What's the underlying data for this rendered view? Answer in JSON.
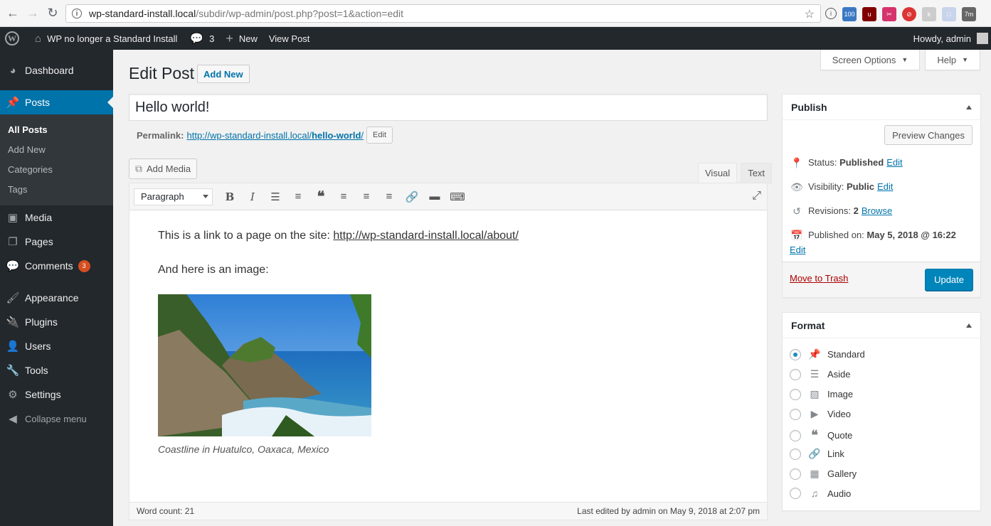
{
  "browser": {
    "url_host": "wp-standard-install.local",
    "url_path": "/subdir/wp-admin/post.php?post=1&action=edit",
    "ext_badge": "100",
    "ext_time": "7m"
  },
  "admin_bar": {
    "site_name": "WP no longer a Standard Install",
    "comments_count": "3",
    "new_label": "New",
    "view_post_label": "View Post",
    "howdy": "Howdy, admin"
  },
  "sidebar": {
    "dashboard": "Dashboard",
    "posts": "Posts",
    "submenu": [
      "All Posts",
      "Add New",
      "Categories",
      "Tags"
    ],
    "media": "Media",
    "pages": "Pages",
    "comments": "Comments",
    "comments_badge": "3",
    "appearance": "Appearance",
    "plugins": "Plugins",
    "users": "Users",
    "tools": "Tools",
    "settings": "Settings",
    "collapse": "Collapse menu"
  },
  "screen_tabs": {
    "screen_options": "Screen Options",
    "help": "Help"
  },
  "header": {
    "title": "Edit Post",
    "add_new": "Add New"
  },
  "post": {
    "title": "Hello world!",
    "permalink_label": "Permalink:",
    "permalink_base": "http://wp-standard-install.local/",
    "permalink_slug": "hello-world",
    "permalink_end": "/",
    "permalink_edit": "Edit"
  },
  "editor": {
    "add_media": "Add Media",
    "tab_visual": "Visual",
    "tab_text": "Text",
    "format_select": "Paragraph",
    "paragraph1_text": "This is a link to a page on the site: ",
    "paragraph1_link": "http://wp-standard-install.local/about/",
    "paragraph2": "And here is an image:",
    "caption": "Coastline in Huatulco, Oaxaca, Mexico",
    "word_count": "Word count: 21",
    "last_edited": "Last edited by admin on May 9, 2018 at 2:07 pm"
  },
  "publish": {
    "title": "Publish",
    "preview": "Preview Changes",
    "status_label": "Status:",
    "status_value": "Published",
    "visibility_label": "Visibility:",
    "visibility_value": "Public",
    "revisions_label": "Revisions:",
    "revisions_value": "2",
    "browse": "Browse",
    "published_label": "Published on:",
    "published_value": "May 5, 2018 @ 16:22",
    "edit": "Edit",
    "trash": "Move to Trash",
    "update": "Update"
  },
  "format": {
    "title": "Format",
    "options": [
      "Standard",
      "Aside",
      "Image",
      "Video",
      "Quote",
      "Link",
      "Gallery",
      "Audio"
    ],
    "selected": "Standard"
  }
}
